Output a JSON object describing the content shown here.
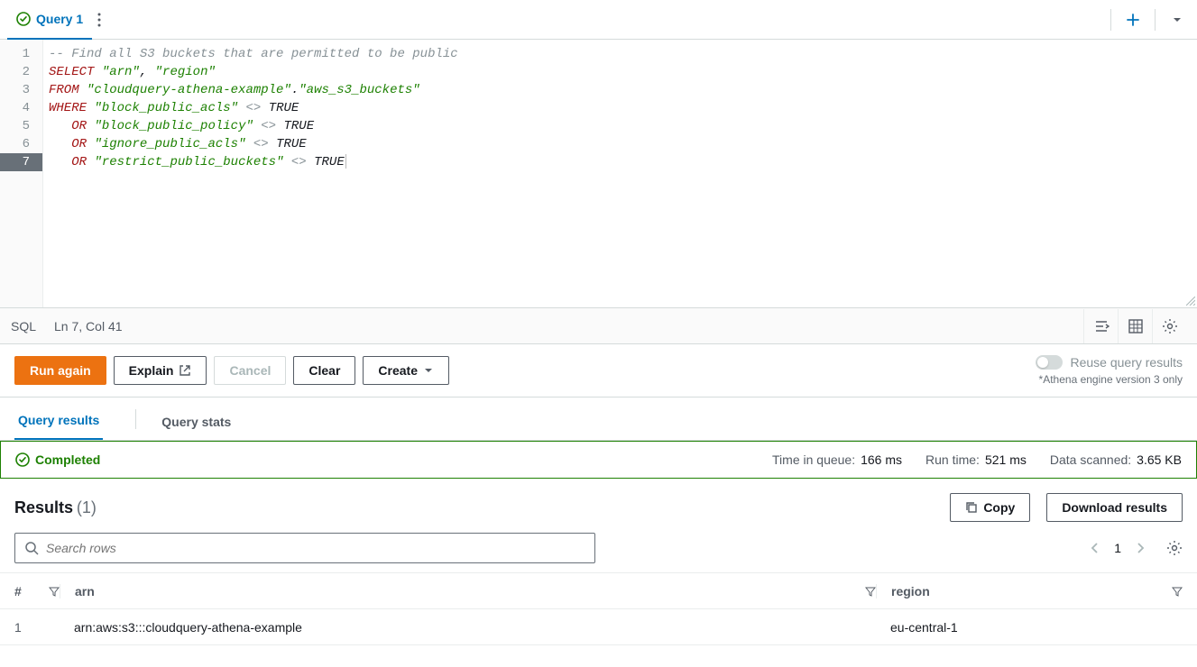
{
  "tabs": {
    "query1": "Query 1"
  },
  "editor": {
    "lines": [
      "1",
      "2",
      "3",
      "4",
      "5",
      "6",
      "7"
    ],
    "active_line": "7",
    "code": {
      "comment": "-- Find all S3 buckets that are permitted to be public",
      "kw_select": "SELECT",
      "sel_arn": "\"arn\"",
      "comma": ", ",
      "sel_region": "\"region\"",
      "kw_from": "FROM",
      "db": "\"cloudquery-athena-example\"",
      "dot": ".",
      "tbl": "\"aws_s3_buckets\"",
      "kw_where": "WHERE",
      "col_bpa": "\"block_public_acls\"",
      "op_ne": "<>",
      "true": "TRUE",
      "kw_or": "OR",
      "col_bpp": "\"block_public_policy\"",
      "col_ipa": "\"ignore_public_acls\"",
      "col_rpb": "\"restrict_public_buckets\""
    }
  },
  "statusbar": {
    "lang": "SQL",
    "pos": "Ln 7, Col 41"
  },
  "actions": {
    "run": "Run again",
    "explain": "Explain",
    "cancel": "Cancel",
    "clear": "Clear",
    "create": "Create",
    "reuse": "Reuse query results",
    "engine_note": "*Athena engine version 3 only"
  },
  "result_tabs": {
    "results": "Query results",
    "stats": "Query stats"
  },
  "banner": {
    "status": "Completed",
    "queue_label": "Time in queue:",
    "queue_value": "166 ms",
    "run_label": "Run time:",
    "run_value": "521 ms",
    "scan_label": "Data scanned:",
    "scan_value": "3.65 KB"
  },
  "results": {
    "title": "Results",
    "count": "(1)",
    "copy": "Copy",
    "download": "Download results",
    "search_placeholder": "Search rows",
    "page": "1",
    "columns": {
      "idx": "#",
      "arn": "arn",
      "region": "region"
    },
    "rows": [
      {
        "idx": "1",
        "arn": "arn:aws:s3:::cloudquery-athena-example",
        "region": "eu-central-1"
      }
    ]
  }
}
